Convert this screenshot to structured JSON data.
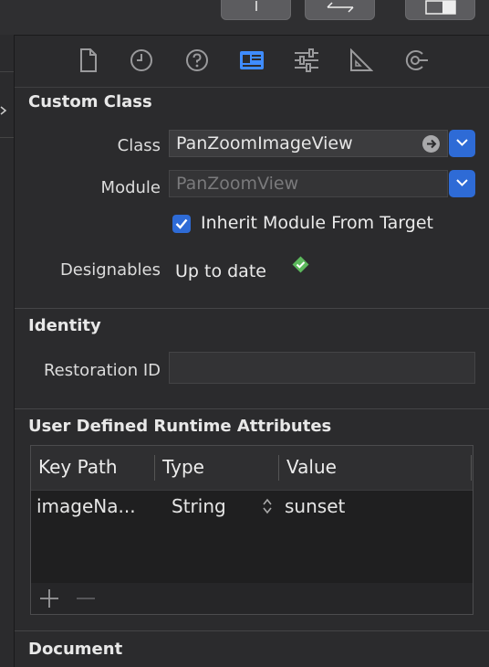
{
  "toolbar": {
    "buttons": [
      "share-up-icon",
      "swap-arrows-icon",
      "layout-toggle-icon"
    ]
  },
  "inspector_tabs": [
    {
      "name": "file-inspector-icon",
      "active": false
    },
    {
      "name": "history-inspector-icon",
      "active": false
    },
    {
      "name": "quick-help-icon",
      "active": false
    },
    {
      "name": "identity-inspector-icon",
      "active": true
    },
    {
      "name": "attributes-inspector-icon",
      "active": false
    },
    {
      "name": "size-inspector-icon",
      "active": false
    },
    {
      "name": "connections-inspector-icon",
      "active": false
    }
  ],
  "custom_class": {
    "title": "Custom Class",
    "class_label": "Class",
    "class_value": "PanZoomImageView",
    "module_label": "Module",
    "module_placeholder": "PanZoomView",
    "inherit_label": "Inherit Module From Target",
    "inherit_checked": true,
    "designables_label": "Designables",
    "designables_value": "Up to date"
  },
  "identity": {
    "title": "Identity",
    "restoration_label": "Restoration ID",
    "restoration_value": ""
  },
  "runtime_attributes": {
    "title": "User Defined Runtime Attributes",
    "columns": [
      "Key Path",
      "Type",
      "Value"
    ],
    "rows": [
      {
        "key_path": "imageNa...",
        "type": "String",
        "value": "sunset"
      }
    ]
  },
  "document": {
    "title": "Document"
  },
  "colors": {
    "accent": "#2e6bd6",
    "status_ok": "#5cb85c",
    "background": "#2b2b2d"
  }
}
